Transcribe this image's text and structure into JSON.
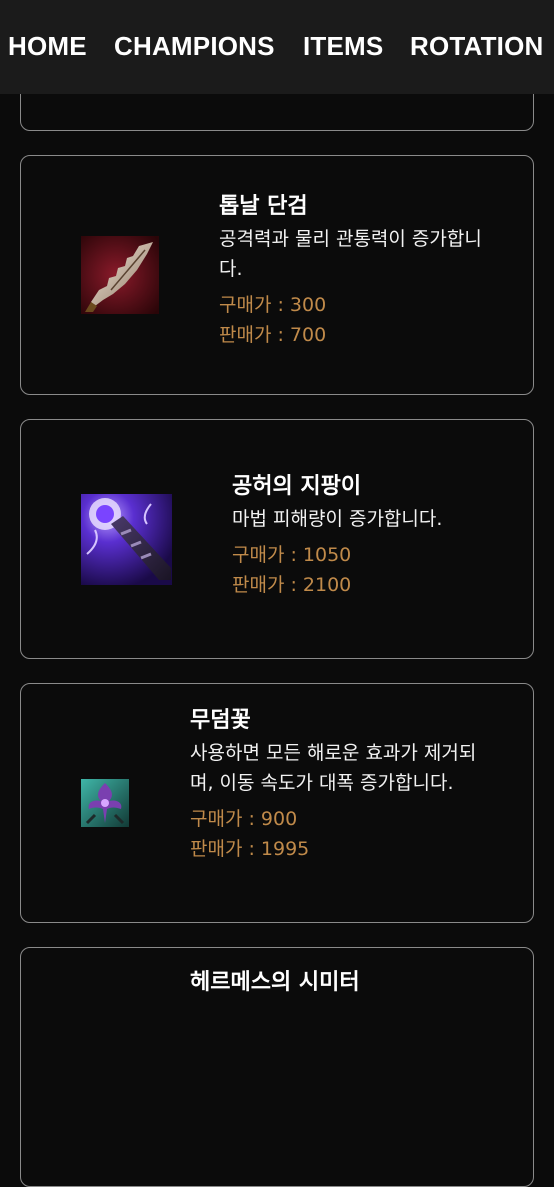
{
  "nav": {
    "items": [
      "HOME",
      "CHAMPIONS",
      "ITEMS",
      "ROTATION"
    ]
  },
  "items": [
    {
      "name": "톱날 단검",
      "description": "공격력과 물리 관통력이 증가합니다.",
      "buy": "구매가 : 300",
      "sell": "판매가 : 700",
      "icon": "serrated-dirk-icon"
    },
    {
      "name": "공허의 지팡이",
      "description": "마법 피해량이 증가합니다.",
      "buy": "구매가 : 1050",
      "sell": "판매가 : 2100",
      "icon": "void-staff-icon"
    },
    {
      "name": "무덤꽃",
      "description": "사용하면 모든 해로운 효과가 제거되며, 이동 속도가 대폭 증가합니다.",
      "buy": "구매가 : 900",
      "sell": "판매가 : 1995",
      "icon": "grave-flower-icon"
    },
    {
      "name": "헤르메스의 시미터",
      "icon": "item-icon"
    }
  ],
  "colors": {
    "background": "#0b0b0b",
    "nav_background": "#1b1b1b",
    "card_border": "#8a8a8a",
    "price": "#c08a4a"
  }
}
